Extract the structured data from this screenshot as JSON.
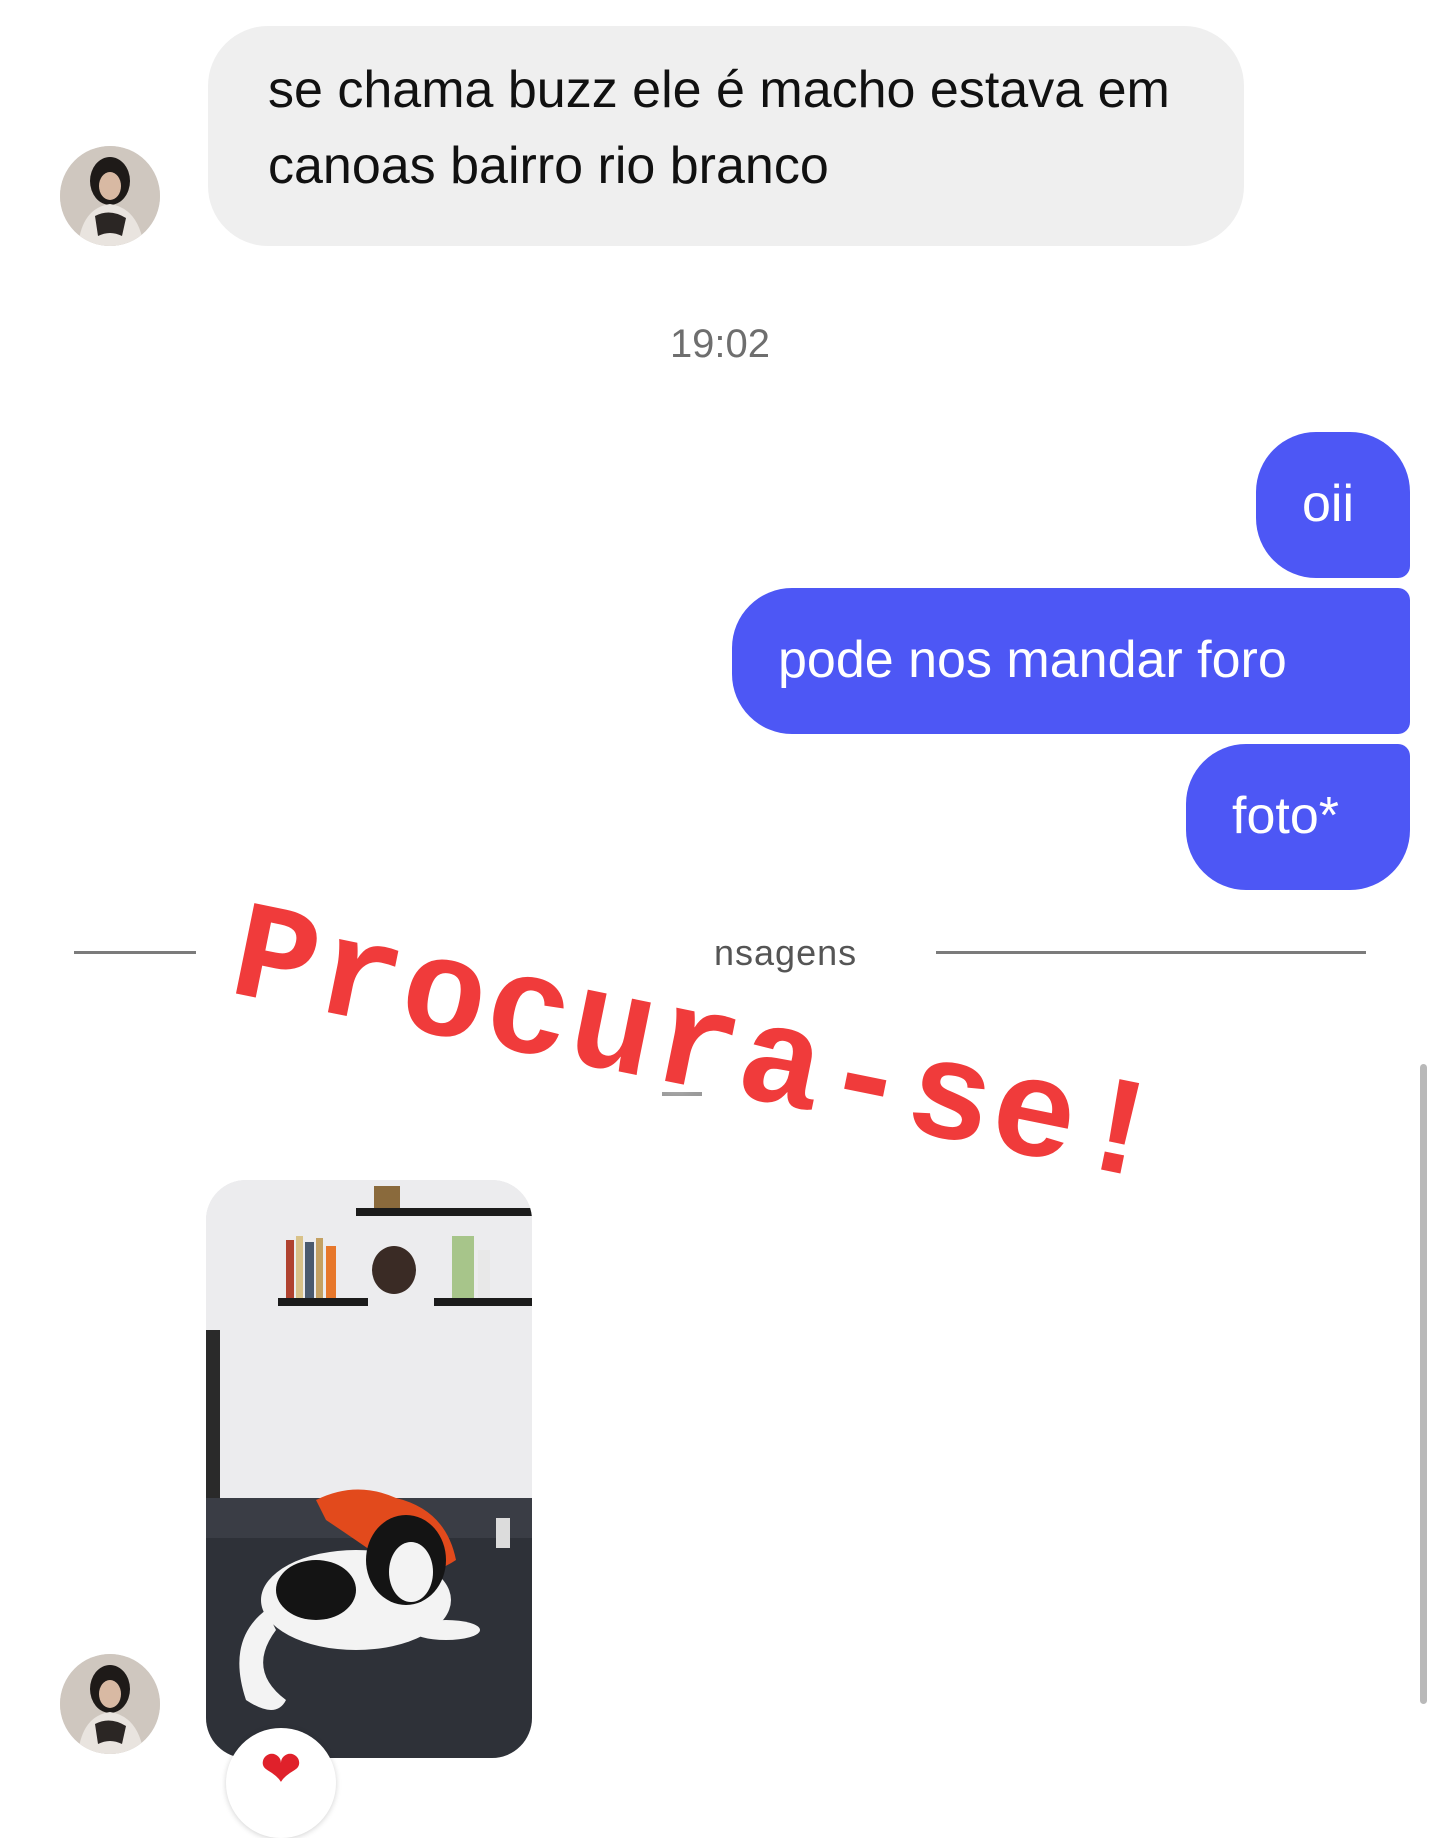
{
  "messages": {
    "incoming_1": "se chama buzz ele é macho estava em canoas bairro rio branco",
    "timestamp": "19:02",
    "outgoing": [
      "oii",
      "pode nos mandar foro",
      "foto*"
    ]
  },
  "divider": {
    "label": "nsagens"
  },
  "overlay": {
    "sticker_text": "Procura-se!"
  },
  "reaction": {
    "emoji": "❤"
  },
  "colors": {
    "outgoing_bubble": "#4d57f5",
    "incoming_bubble": "#efefef",
    "sticker": "#f03b3b"
  }
}
